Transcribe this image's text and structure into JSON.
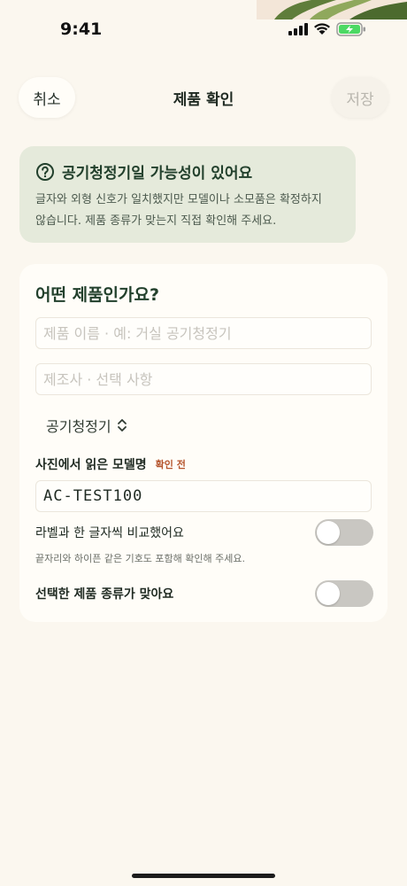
{
  "status": {
    "time": "9:41"
  },
  "nav": {
    "cancel": "취소",
    "title": "제품 확인",
    "save": "저장"
  },
  "notice": {
    "title": "공기청정기일 가능성이 있어요",
    "line1": "글자와 외형 신호가 일치했지만 모델이나 소모품은 확정하지",
    "line2": "않습니다. 제품 종류가 맞는지 직접 확인해 주세요."
  },
  "form": {
    "title": "어떤 제품인가요?",
    "name_placeholder": "제품 이름 · 예: 거실 공기청정기",
    "maker_placeholder": "제조사 · 선택 사항",
    "category": "공기청정기",
    "model_label": "사진에서 읽은 모델명",
    "model_badge": "확인 전",
    "model_value": "AC-TEST100",
    "compare_label": "라벨과 한 글자씩 비교했어요",
    "compare_hint": "끝자리와 하이픈 같은 기호도 포함해 확인해 주세요.",
    "compare_on": false,
    "category_confirm_label": "선택한 제품 종류가 맞아요",
    "category_confirm_on": false
  },
  "colors": {
    "accent": "#22402c",
    "badge": "#b5542c",
    "notice_bg": "#e5eadb",
    "background": "#fbf7ef"
  }
}
